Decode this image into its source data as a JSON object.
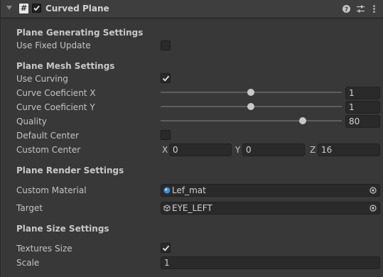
{
  "component": {
    "title": "Curved Plane",
    "enabled": true
  },
  "sections": {
    "generating": "Plane Generating Settings",
    "mesh": "Plane Mesh Settings",
    "render": "Plane Render Settings",
    "size": "Plane Size Settings"
  },
  "fields": {
    "use_fixed_update": {
      "label": "Use Fixed Update",
      "checked": false
    },
    "use_curving": {
      "label": "Use Curving",
      "checked": true
    },
    "curve_x": {
      "label": "Curve Coeficient X",
      "value": "1",
      "fraction": 0.5
    },
    "curve_y": {
      "label": "Curve Coeficient Y",
      "value": "1",
      "fraction": 0.5
    },
    "quality": {
      "label": "Quality",
      "value": "80",
      "fraction": 0.79
    },
    "default_center": {
      "label": "Default Center",
      "checked": false
    },
    "custom_center": {
      "label": "Custom Center",
      "x_label": "X",
      "x": "0",
      "y_label": "Y",
      "y": "0",
      "z_label": "Z",
      "z": "16"
    },
    "custom_material": {
      "label": "Custom Material",
      "value": "Lef_mat"
    },
    "target": {
      "label": "Target",
      "value": "EYE_LEFT"
    },
    "textures_size": {
      "label": "Textures Size",
      "checked": true
    },
    "scale": {
      "label": "Scale",
      "value": "1"
    }
  },
  "icons": {
    "script": "script-icon",
    "help": "help-icon",
    "presets": "presets-icon",
    "menu": "kebab-menu-icon"
  }
}
